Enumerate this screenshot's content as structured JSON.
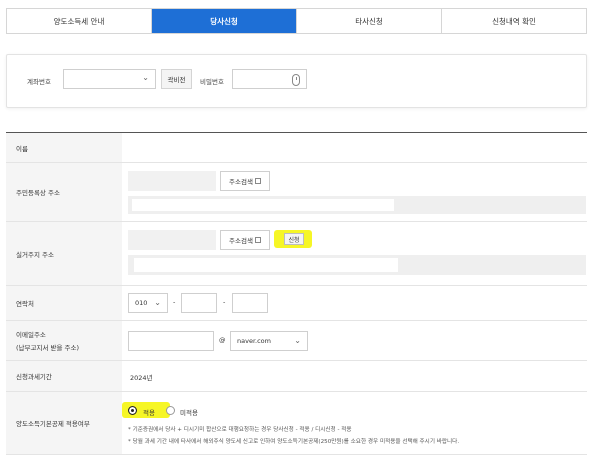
{
  "tabs": [
    {
      "label": "양도소득세 안내"
    },
    {
      "label": "당사신청"
    },
    {
      "label": "타사신청"
    },
    {
      "label": "신청내역 확인"
    }
  ],
  "active_tab": 1,
  "account": {
    "account_label": "계좌번호",
    "account_value": "",
    "lookup_button": "곽비전",
    "password_label": "비밀번호",
    "password_value": ""
  },
  "form": {
    "name_label": "이름",
    "name_value": "",
    "resident_address_label": "주민등록상 주소",
    "address_search_button": "주소검색",
    "actual_address_label": "실거주지 주소",
    "apply_button": "신청",
    "contact_label": "연락처",
    "phone_prefix": "010",
    "phone_sep1": "-",
    "phone_sep2": "-",
    "phone_mid": "",
    "phone_last": "",
    "email_label": "이메일주소",
    "email_sublabel": "(납부고지서 받을 주소)",
    "email_at": "@",
    "email_domain": "naver.com",
    "email_local": "",
    "period_label": "신청과세기간",
    "period_value": "2024년",
    "deduction_label": "양도소득기본공제 적용여부",
    "radio_apply": "적용",
    "radio_not_apply": "미적용",
    "note1": "* 기준증권에서 당사 + 디시기미 합산으로 대행요청하는 경우 당사신청 - 적용 / 디시신청 - 적용",
    "note2": "* 당월 과세 기간 내에 타사에서 해외주식 양도세 신고로 인하여 양도소득기본공제(250만원)를 소요한 경우 미적용을 선택해 주시기 바랍니다."
  },
  "colors": {
    "active_tab": "#1e6fd6",
    "highlight": "#f5f500"
  }
}
